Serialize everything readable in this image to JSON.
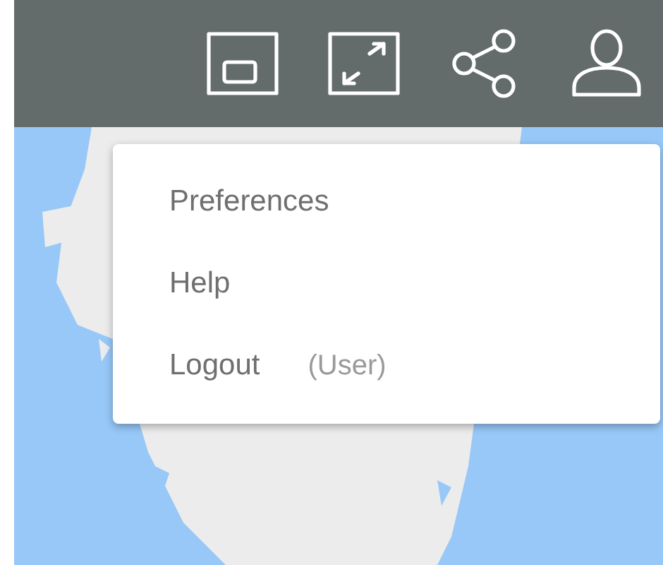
{
  "toolbar": {
    "buttons": [
      {
        "kind": "pip"
      },
      {
        "kind": "fullscreen"
      },
      {
        "kind": "share"
      },
      {
        "kind": "user"
      }
    ]
  },
  "menu": {
    "items": [
      {
        "label": "Preferences"
      },
      {
        "label": "Help"
      },
      {
        "label": "Logout",
        "note": "(User)"
      }
    ]
  }
}
